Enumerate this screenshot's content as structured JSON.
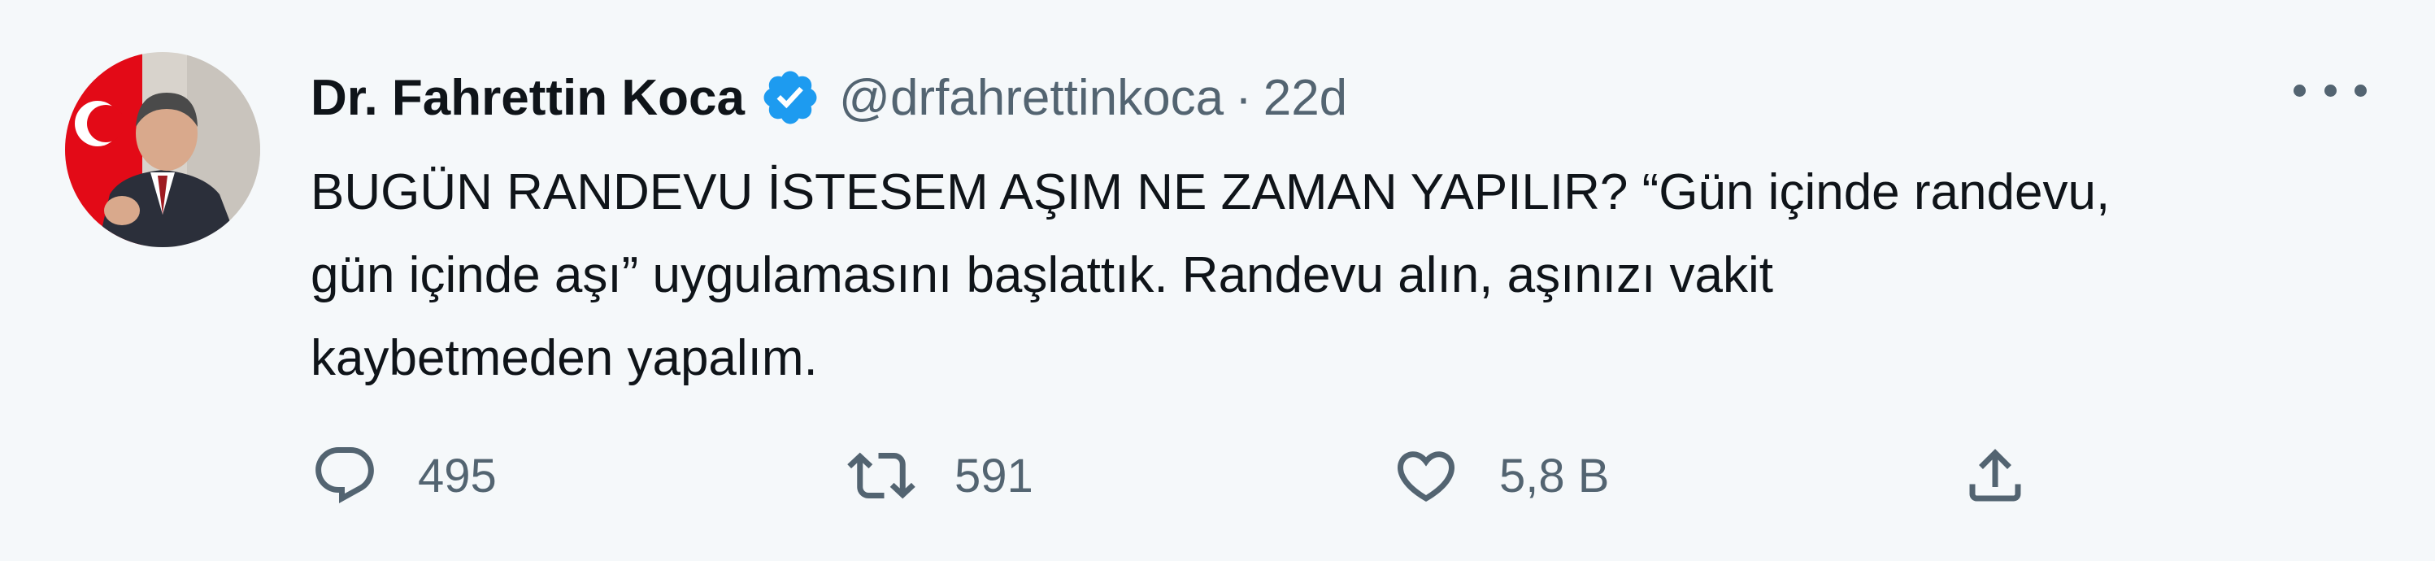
{
  "tweet": {
    "author": {
      "display_name": "Dr. Fahrettin Koca",
      "handle": "@drfahrettinkoca",
      "verified_icon": "verified-badge-icon"
    },
    "separator": "·",
    "time": "22d",
    "text_lines": [
      "BUGÜN RANDEVU İSTESEM AŞIM NE ZAMAN YAPILIR? “Gün içinde randevu,",
      "gün içinde aşı” uygulamasını başlattık. Randevu alın, aşınızı vakit",
      "kaybetmeden yapalım."
    ],
    "actions": {
      "reply": {
        "icon": "reply-icon",
        "count": "495"
      },
      "retweet": {
        "icon": "retweet-icon",
        "count": "591"
      },
      "like": {
        "icon": "heart-icon",
        "count": "5,8 B"
      },
      "share": {
        "icon": "share-icon"
      }
    },
    "more_icon": "more-icon"
  },
  "colors": {
    "background": "#f5f8fa",
    "text": "#0f1419",
    "secondary": "#536471",
    "verified": "#1d9bf0",
    "flag_red": "#e30a17"
  }
}
